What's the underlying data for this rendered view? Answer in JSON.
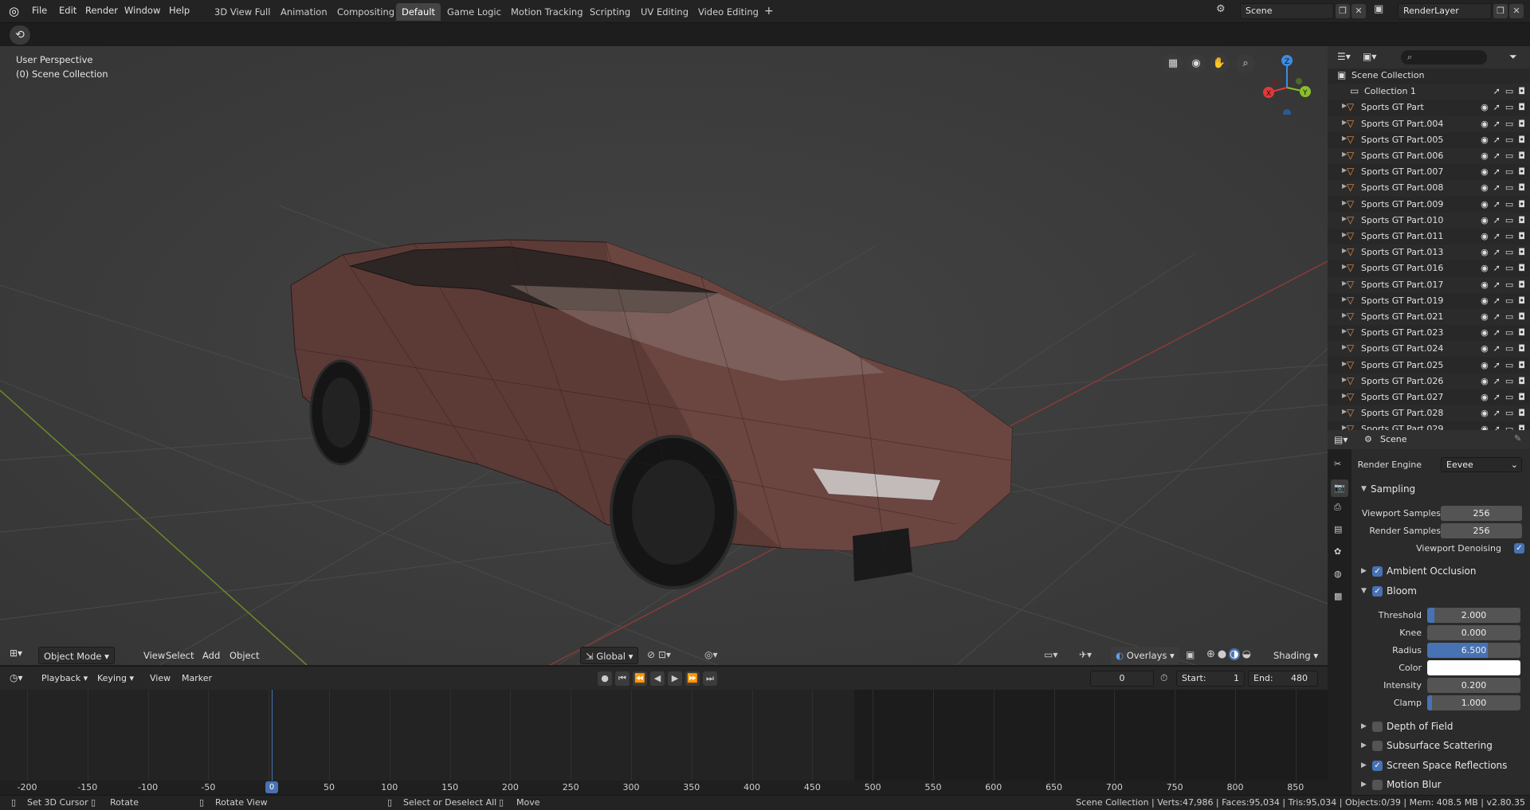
{
  "menu": {
    "logo": "blender-logo",
    "items": [
      "File",
      "Edit",
      "Render",
      "Window",
      "Help"
    ]
  },
  "workspaces": {
    "tabs": [
      "3D View Full",
      "Animation",
      "Compositing",
      "Default",
      "Game Logic",
      "Motion Tracking",
      "Scripting",
      "UV Editing",
      "Video Editing"
    ],
    "active": "Default",
    "add": "+"
  },
  "scene_field": {
    "value": "Scene"
  },
  "layer_field": {
    "value": "RenderLayer"
  },
  "viewport": {
    "perspective": "User Perspective",
    "collection": "(0) Scene Collection",
    "gizmo": {
      "x": "X",
      "y": "Y",
      "z": "Z"
    }
  },
  "vp_header": {
    "mode": "Object Mode",
    "view": "View",
    "select": "Select",
    "add": "Add",
    "object": "Object",
    "transform": "Global",
    "overlays": "Overlays",
    "shading": "Shading"
  },
  "timeline_hdr": {
    "playback": "Playback",
    "keying": "Keying",
    "view": "View",
    "marker": "Marker",
    "current": "0",
    "start_label": "Start:",
    "start": "1",
    "end_label": "End:",
    "end": "480"
  },
  "timeline": {
    "ticks": [
      "-200",
      "-150",
      "-100",
      "-50",
      "0",
      "50",
      "100",
      "150",
      "200",
      "250",
      "300",
      "350",
      "400",
      "450",
      "500",
      "550",
      "600",
      "650",
      "700",
      "750",
      "800",
      "850"
    ],
    "current_frame": "0"
  },
  "outliner": {
    "root": "Scene Collection",
    "collection": "Collection 1",
    "items": [
      "Sports GT Part",
      "Sports GT Part.004",
      "Sports GT Part.005",
      "Sports GT Part.006",
      "Sports GT Part.007",
      "Sports GT Part.008",
      "Sports GT Part.009",
      "Sports GT Part.010",
      "Sports GT Part.011",
      "Sports GT Part.013",
      "Sports GT Part.016",
      "Sports GT Part.017",
      "Sports GT Part.019",
      "Sports GT Part.021",
      "Sports GT Part.023",
      "Sports GT Part.024",
      "Sports GT Part.025",
      "Sports GT Part.026",
      "Sports GT Part.027",
      "Sports GT Part.028",
      "Sports GT Part.029"
    ]
  },
  "properties": {
    "context": "Scene",
    "render_engine_label": "Render Engine",
    "render_engine": "Eevee",
    "sampling": {
      "title": "Sampling",
      "viewport_label": "Viewport Samples",
      "viewport": "256",
      "render_label": "Render Samples",
      "render": "256",
      "denoise_label": "Viewport Denoising",
      "denoise": true
    },
    "ambient_occlusion": {
      "title": "Ambient Occlusion",
      "enabled": true
    },
    "bloom": {
      "title": "Bloom",
      "enabled": true,
      "threshold_label": "Threshold",
      "threshold": "2.000",
      "threshold_fill": 0.08,
      "knee_label": "Knee",
      "knee": "0.000",
      "knee_fill": 0,
      "radius_label": "Radius",
      "radius": "6.500",
      "radius_fill": 0.65,
      "color_label": "Color",
      "color": "#ffffff",
      "intensity_label": "Intensity",
      "intensity": "0.200",
      "intensity_fill": 0,
      "clamp_label": "Clamp",
      "clamp": "1.000",
      "clamp_fill": 0.05
    },
    "collapsed": [
      {
        "title": "Depth of Field",
        "enabled": false
      },
      {
        "title": "Subsurface Scattering",
        "enabled": false
      },
      {
        "title": "Screen Space Reflections",
        "enabled": true
      },
      {
        "title": "Motion Blur",
        "enabled": false
      }
    ]
  },
  "status": {
    "cursor": "Set 3D Cursor",
    "rotate": "Rotate",
    "rotate_view": "Rotate View",
    "select": "Select or Deselect All",
    "move": "Move",
    "stats": "Scene Collection | Verts:47,986 | Faces:95,034 | Tris:95,034 | Objects:0/39 | Mem: 408.5 MB | v2.80.35"
  },
  "colors": {
    "accent": "#4772b3",
    "mesh_icon": "#e8904a",
    "axis_x": "#e0383b",
    "axis_y": "#8bbf2a",
    "axis_z": "#3c8de0"
  }
}
